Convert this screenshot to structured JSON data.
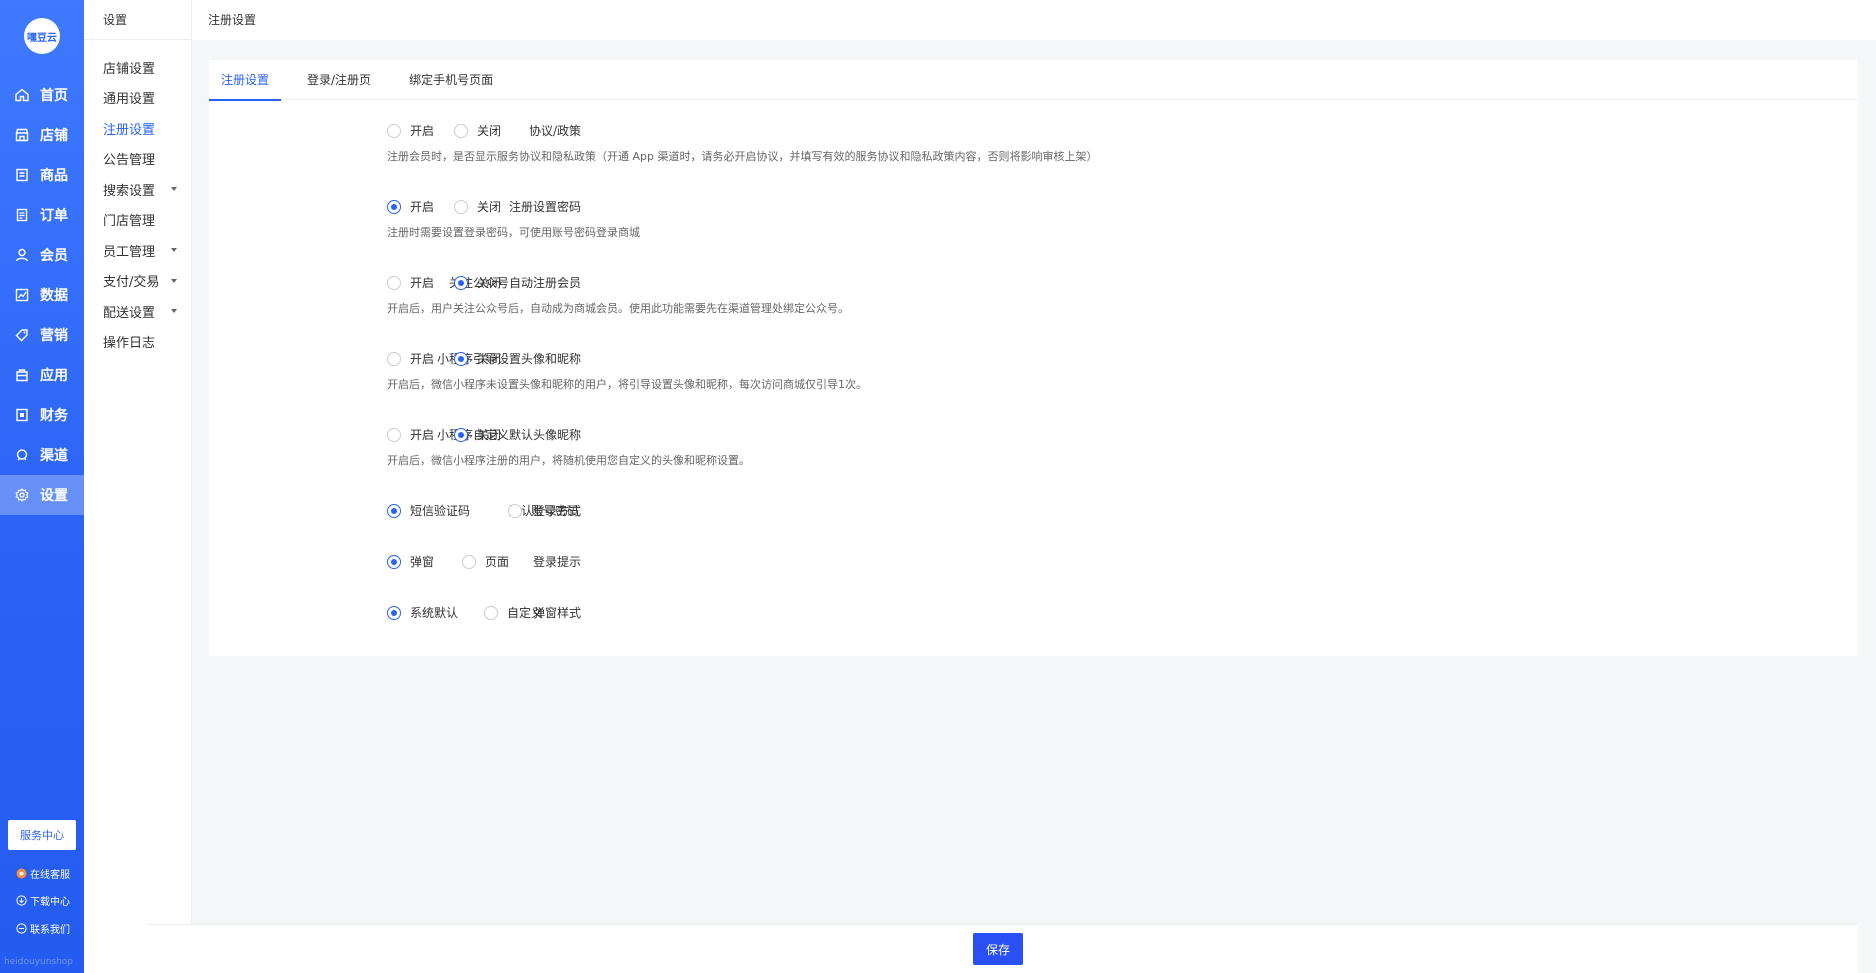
{
  "app": {
    "logo_text": "嘿豆云"
  },
  "sidebar": {
    "items": [
      {
        "label": "首页",
        "icon": "home-icon"
      },
      {
        "label": "店铺",
        "icon": "store-icon"
      },
      {
        "label": "商品",
        "icon": "product-icon"
      },
      {
        "label": "订单",
        "icon": "order-icon"
      },
      {
        "label": "会员",
        "icon": "user-icon"
      },
      {
        "label": "数据",
        "icon": "chart-icon"
      },
      {
        "label": "营销",
        "icon": "tag-icon"
      },
      {
        "label": "应用",
        "icon": "app-icon"
      },
      {
        "label": "财务",
        "icon": "finance-icon"
      },
      {
        "label": "渠道",
        "icon": "channel-icon"
      },
      {
        "label": "设置",
        "icon": "gear-icon"
      }
    ],
    "active_index": 10,
    "service_button": "服务中心",
    "links": [
      {
        "label": "在线客服",
        "icon": "chat-icon"
      },
      {
        "label": "下载中心",
        "icon": "download-icon"
      },
      {
        "label": "联系我们",
        "icon": "contact-icon"
      }
    ],
    "footer_text": "heidouyunshop"
  },
  "subsidebar": {
    "title": "设置",
    "items": [
      {
        "label": "店铺设置",
        "has_children": false
      },
      {
        "label": "通用设置",
        "has_children": false
      },
      {
        "label": "注册设置",
        "has_children": false
      },
      {
        "label": "公告管理",
        "has_children": false
      },
      {
        "label": "搜索设置",
        "has_children": true
      },
      {
        "label": "门店管理",
        "has_children": false
      },
      {
        "label": "员工管理",
        "has_children": true
      },
      {
        "label": "支付/交易",
        "has_children": true
      },
      {
        "label": "配送设置",
        "has_children": true
      },
      {
        "label": "操作日志",
        "has_children": false
      }
    ],
    "active_index": 2
  },
  "header": {
    "breadcrumb": "注册设置"
  },
  "tabs": [
    {
      "label": "注册设置",
      "active": true
    },
    {
      "label": "登录/注册页",
      "active": false
    },
    {
      "label": "绑定手机号页面",
      "active": false
    }
  ],
  "settings": [
    {
      "label": "协议/政策",
      "options": [
        "开启",
        "关闭"
      ],
      "selected": -1,
      "hint": "注册会员时，是否显示服务协议和隐私政策（开通 App 渠道时，请务必开启协议，并填写有效的服务协议和隐私政策内容，否则将影响审核上架）"
    },
    {
      "label": "注册设置密码",
      "options": [
        "开启",
        "关闭"
      ],
      "selected": 0,
      "hint": "注册时需要设置登录密码，可使用账号密码登录商城"
    },
    {
      "label": "关注公众号自动注册会员",
      "options": [
        "开启",
        "关闭"
      ],
      "selected": 1,
      "hint": "开启后，用户关注公众号后，自动成为商城会员。使用此功能需要先在渠道管理处绑定公众号。"
    },
    {
      "label": "小程序引导设置头像和昵称",
      "options": [
        "开启",
        "关闭"
      ],
      "selected": 1,
      "hint": "开启后，微信小程序未设置头像和昵称的用户，将引导设置头像和昵称，每次访问商城仅引导1次。"
    },
    {
      "label": "小程序自定义默认头像昵称",
      "options": [
        "开启",
        "关闭"
      ],
      "selected": 1,
      "hint": "开启后，微信小程序注册的用户，将随机使用您自定义的头像和昵称设置。"
    },
    {
      "label": "默认登录方式",
      "options": [
        "短信验证码",
        "账号密码"
      ],
      "selected": 0,
      "hint": ""
    },
    {
      "label": "登录提示",
      "options": [
        "弹窗",
        "页面"
      ],
      "selected": 0,
      "hint": ""
    },
    {
      "label": "弹窗样式",
      "options": [
        "系统默认",
        "自定义"
      ],
      "selected": 0,
      "hint": ""
    }
  ],
  "footer": {
    "save_label": "保存"
  },
  "colors": {
    "primary": "#2a62f5",
    "sidebar_top": "#3f79ff"
  }
}
